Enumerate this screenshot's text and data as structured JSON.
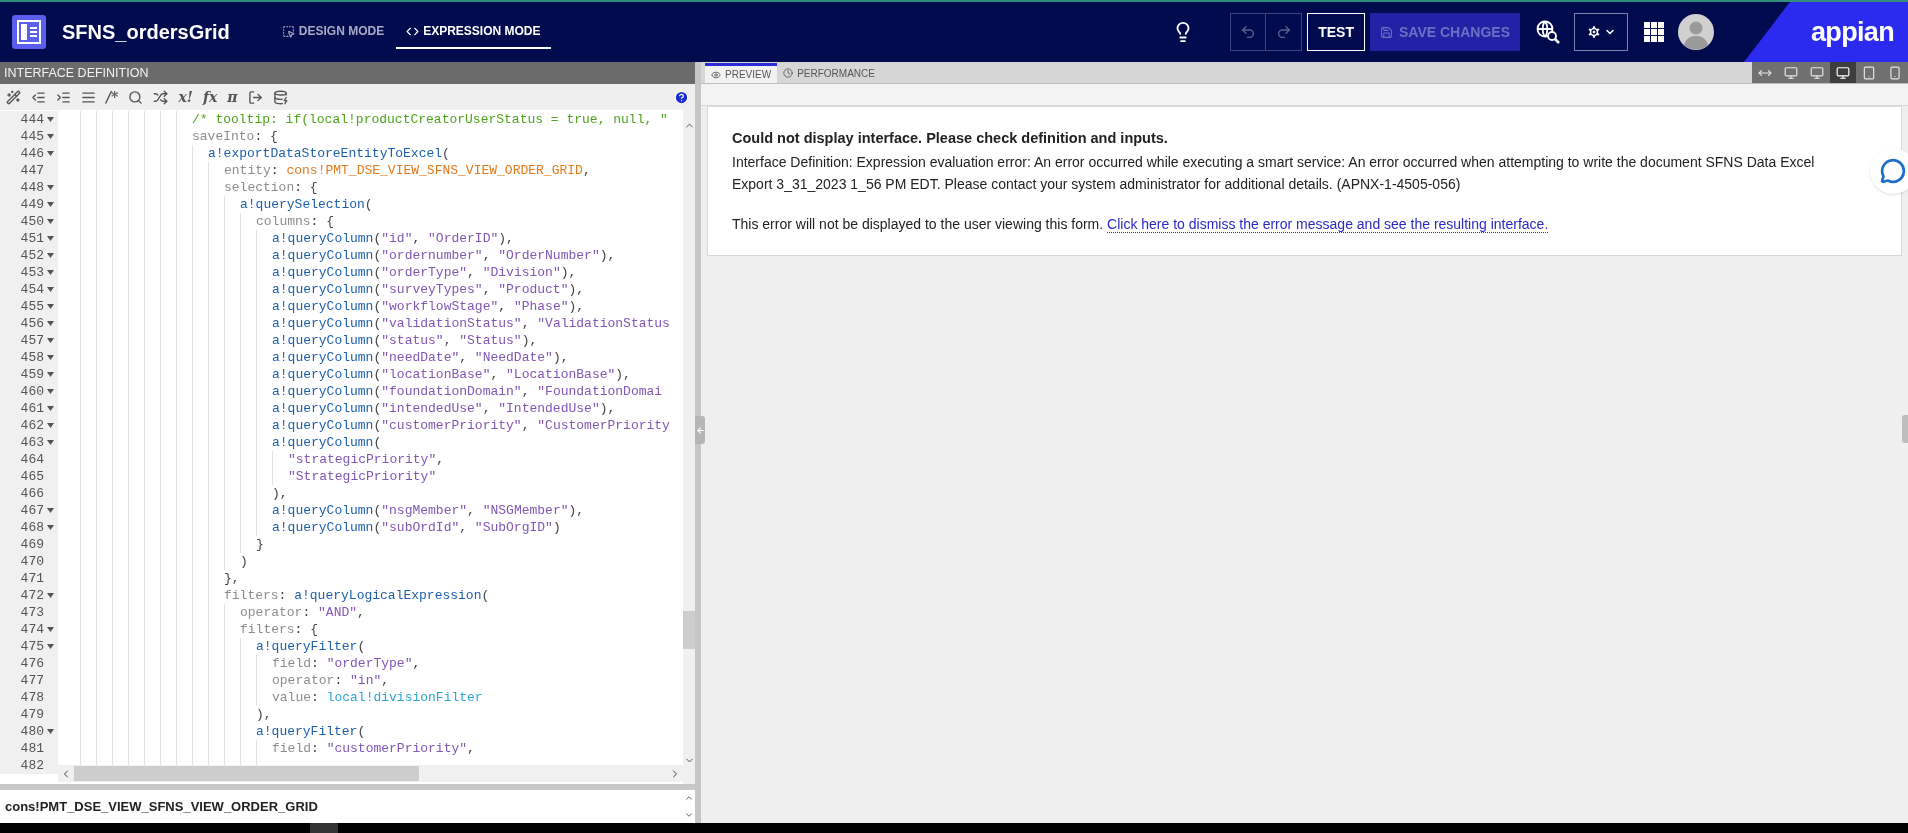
{
  "app": {
    "title": "SFNS_ordersGrid",
    "modes": [
      {
        "label": "DESIGN MODE",
        "selected": false
      },
      {
        "label": "EXPRESSION MODE",
        "selected": true
      }
    ],
    "undo": {
      "disabled": true
    },
    "redo": {
      "disabled": true
    },
    "test_button": "TEST",
    "save_button": {
      "label": "SAVE CHANGES",
      "disabled": true
    },
    "logo": "appian"
  },
  "editor": {
    "title": "INTERFACE DEFINITION",
    "toolbar": [
      {
        "kind": "icon"
      },
      {
        "kind": "icon"
      },
      {
        "kind": "icon"
      },
      {
        "kind": "icon"
      },
      {
        "kind": "glyph",
        "text": "/*"
      },
      {
        "kind": "icon"
      },
      {
        "kind": "icon"
      },
      {
        "kind": "glyph",
        "text": "x!"
      },
      {
        "kind": "glyph",
        "text": "fx"
      },
      {
        "kind": "glyph",
        "text": "π"
      },
      {
        "kind": "icon"
      },
      {
        "kind": "icon"
      }
    ],
    "lines": [
      {
        "number": "444",
        "foldable": true,
        "code": [
          {
            "kind": "comment",
            "text": "/* tooltip: if(local!productCreatorUserStatus = true, null, \""
          }
        ]
      },
      {
        "number": "445",
        "foldable": true,
        "code": [
          {
            "kind": "key",
            "text": "saveInto"
          },
          {
            "kind": "punct",
            "text": ": {"
          }
        ],
        "children": [
          {
            "number": "446",
            "foldable": true,
            "code": [
              {
                "kind": "func",
                "text": "a!exportDataStoreEntityToExcel"
              },
              {
                "kind": "punct",
                "text": "("
              }
            ],
            "children": [
              {
                "number": "447",
                "foldable": false,
                "code": [
                  {
                    "kind": "key",
                    "text": "entity"
                  },
                  {
                    "kind": "punct",
                    "text": ": "
                  },
                  {
                    "kind": "constant",
                    "text": "cons!PMT_DSE_VIEW_SFNS_VIEW_ORDER_GRID"
                  },
                  {
                    "kind": "punct",
                    "text": ","
                  }
                ]
              },
              {
                "number": "448",
                "foldable": true,
                "code": [
                  {
                    "kind": "key",
                    "text": "selection"
                  },
                  {
                    "kind": "punct",
                    "text": ": {"
                  }
                ],
                "children": [
                  {
                    "number": "449",
                    "foldable": true,
                    "code": [
                      {
                        "kind": "func",
                        "text": "a!querySelection"
                      },
                      {
                        "kind": "punct",
                        "text": "("
                      }
                    ],
                    "children": [
                      {
                        "number": "450",
                        "foldable": true,
                        "code": [
                          {
                            "kind": "key",
                            "text": "columns"
                          },
                          {
                            "kind": "punct",
                            "text": ": {"
                          }
                        ],
                        "children": [
                          {
                            "number": "451",
                            "foldable": true,
                            "code": [
                              {
                                "kind": "func",
                                "text": "a!queryColumn"
                              },
                              {
                                "kind": "punct",
                                "text": "("
                              },
                              {
                                "kind": "string",
                                "text": "\"id\""
                              },
                              {
                                "kind": "punct",
                                "text": ", "
                              },
                              {
                                "kind": "string",
                                "text": "\"OrderID\""
                              },
                              {
                                "kind": "punct",
                                "text": "),"
                              }
                            ]
                          },
                          {
                            "number": "452",
                            "foldable": true,
                            "code": [
                              {
                                "kind": "func",
                                "text": "a!queryColumn"
                              },
                              {
                                "kind": "punct",
                                "text": "("
                              },
                              {
                                "kind": "string",
                                "text": "\"ordernumber\""
                              },
                              {
                                "kind": "punct",
                                "text": ", "
                              },
                              {
                                "kind": "string",
                                "text": "\"OrderNumber\""
                              },
                              {
                                "kind": "punct",
                                "text": "),"
                              }
                            ]
                          },
                          {
                            "number": "453",
                            "foldable": true,
                            "code": [
                              {
                                "kind": "func",
                                "text": "a!queryColumn"
                              },
                              {
                                "kind": "punct",
                                "text": "("
                              },
                              {
                                "kind": "string",
                                "text": "\"orderType\""
                              },
                              {
                                "kind": "punct",
                                "text": ", "
                              },
                              {
                                "kind": "string",
                                "text": "\"Division\""
                              },
                              {
                                "kind": "punct",
                                "text": "),"
                              }
                            ]
                          },
                          {
                            "number": "454",
                            "foldable": true,
                            "code": [
                              {
                                "kind": "func",
                                "text": "a!queryColumn"
                              },
                              {
                                "kind": "punct",
                                "text": "("
                              },
                              {
                                "kind": "string",
                                "text": "\"surveyTypes\""
                              },
                              {
                                "kind": "punct",
                                "text": ", "
                              },
                              {
                                "kind": "string",
                                "text": "\"Product\""
                              },
                              {
                                "kind": "punct",
                                "text": "),"
                              }
                            ]
                          },
                          {
                            "number": "455",
                            "foldable": true,
                            "code": [
                              {
                                "kind": "func",
                                "text": "a!queryColumn"
                              },
                              {
                                "kind": "punct",
                                "text": "("
                              },
                              {
                                "kind": "string",
                                "text": "\"workflowStage\""
                              },
                              {
                                "kind": "punct",
                                "text": ", "
                              },
                              {
                                "kind": "string",
                                "text": "\"Phase\""
                              },
                              {
                                "kind": "punct",
                                "text": "),"
                              }
                            ]
                          },
                          {
                            "number": "456",
                            "foldable": true,
                            "code": [
                              {
                                "kind": "func",
                                "text": "a!queryColumn"
                              },
                              {
                                "kind": "punct",
                                "text": "("
                              },
                              {
                                "kind": "string",
                                "text": "\"validationStatus\""
                              },
                              {
                                "kind": "punct",
                                "text": ", "
                              },
                              {
                                "kind": "string",
                                "text": "\"ValidationStatus"
                              }
                            ]
                          },
                          {
                            "number": "457",
                            "foldable": true,
                            "code": [
                              {
                                "kind": "func",
                                "text": "a!queryColumn"
                              },
                              {
                                "kind": "punct",
                                "text": "("
                              },
                              {
                                "kind": "string",
                                "text": "\"status\""
                              },
                              {
                                "kind": "punct",
                                "text": ", "
                              },
                              {
                                "kind": "string",
                                "text": "\"Status\""
                              },
                              {
                                "kind": "punct",
                                "text": "),"
                              }
                            ]
                          },
                          {
                            "number": "458",
                            "foldable": true,
                            "code": [
                              {
                                "kind": "func",
                                "text": "a!queryColumn"
                              },
                              {
                                "kind": "punct",
                                "text": "("
                              },
                              {
                                "kind": "string",
                                "text": "\"needDate\""
                              },
                              {
                                "kind": "punct",
                                "text": ", "
                              },
                              {
                                "kind": "string",
                                "text": "\"NeedDate\""
                              },
                              {
                                "kind": "punct",
                                "text": "),"
                              }
                            ]
                          },
                          {
                            "number": "459",
                            "foldable": true,
                            "code": [
                              {
                                "kind": "func",
                                "text": "a!queryColumn"
                              },
                              {
                                "kind": "punct",
                                "text": "("
                              },
                              {
                                "kind": "string",
                                "text": "\"locationBase\""
                              },
                              {
                                "kind": "punct",
                                "text": ", "
                              },
                              {
                                "kind": "string",
                                "text": "\"LocationBase\""
                              },
                              {
                                "kind": "punct",
                                "text": "),"
                              }
                            ]
                          },
                          {
                            "number": "460",
                            "foldable": true,
                            "code": [
                              {
                                "kind": "func",
                                "text": "a!queryColumn"
                              },
                              {
                                "kind": "punct",
                                "text": "("
                              },
                              {
                                "kind": "string",
                                "text": "\"foundationDomain\""
                              },
                              {
                                "kind": "punct",
                                "text": ", "
                              },
                              {
                                "kind": "string",
                                "text": "\"FoundationDomai"
                              }
                            ]
                          },
                          {
                            "number": "461",
                            "foldable": true,
                            "code": [
                              {
                                "kind": "func",
                                "text": "a!queryColumn"
                              },
                              {
                                "kind": "punct",
                                "text": "("
                              },
                              {
                                "kind": "string",
                                "text": "\"intendedUse\""
                              },
                              {
                                "kind": "punct",
                                "text": ", "
                              },
                              {
                                "kind": "string",
                                "text": "\"IntendedUse\""
                              },
                              {
                                "kind": "punct",
                                "text": "),"
                              }
                            ]
                          },
                          {
                            "number": "462",
                            "foldable": true,
                            "code": [
                              {
                                "kind": "func",
                                "text": "a!queryColumn"
                              },
                              {
                                "kind": "punct",
                                "text": "("
                              },
                              {
                                "kind": "string",
                                "text": "\"customerPriority\""
                              },
                              {
                                "kind": "punct",
                                "text": ", "
                              },
                              {
                                "kind": "string",
                                "text": "\"CustomerPriority"
                              }
                            ]
                          },
                          {
                            "number": "463",
                            "foldable": true,
                            "code": [
                              {
                                "kind": "func",
                                "text": "a!queryColumn"
                              },
                              {
                                "kind": "punct",
                                "text": "("
                              }
                            ],
                            "children": [
                              {
                                "number": "464",
                                "foldable": false,
                                "code": [
                                  {
                                    "kind": "string",
                                    "text": "\"strategicPriority\""
                                  },
                                  {
                                    "kind": "punct",
                                    "text": ","
                                  }
                                ]
                              },
                              {
                                "number": "465",
                                "foldable": false,
                                "code": [
                                  {
                                    "kind": "string",
                                    "text": "\"StrategicPriority\""
                                  }
                                ]
                              }
                            ]
                          },
                          {
                            "number": "466",
                            "foldable": false,
                            "code": [
                              {
                                "kind": "punct",
                                "text": "),"
                              }
                            ]
                          },
                          {
                            "number": "467",
                            "foldable": true,
                            "code": [
                              {
                                "kind": "func",
                                "text": "a!queryColumn"
                              },
                              {
                                "kind": "punct",
                                "text": "("
                              },
                              {
                                "kind": "string",
                                "text": "\"nsgMember\""
                              },
                              {
                                "kind": "punct",
                                "text": ", "
                              },
                              {
                                "kind": "string",
                                "text": "\"NSGMember\""
                              },
                              {
                                "kind": "punct",
                                "text": "),"
                              }
                            ]
                          },
                          {
                            "number": "468",
                            "foldable": true,
                            "code": [
                              {
                                "kind": "func",
                                "text": "a!queryColumn"
                              },
                              {
                                "kind": "punct",
                                "text": "("
                              },
                              {
                                "kind": "string",
                                "text": "\"subOrdId\""
                              },
                              {
                                "kind": "punct",
                                "text": ", "
                              },
                              {
                                "kind": "string",
                                "text": "\"SubOrgID\""
                              },
                              {
                                "kind": "punct",
                                "text": ")"
                              }
                            ]
                          }
                        ]
                      },
                      {
                        "number": "469",
                        "foldable": false,
                        "code": [
                          {
                            "kind": "punct",
                            "text": "}"
                          }
                        ]
                      }
                    ]
                  },
                  {
                    "number": "470",
                    "foldable": false,
                    "code": [
                      {
                        "kind": "punct",
                        "text": ")"
                      }
                    ]
                  }
                ]
              },
              {
                "number": "471",
                "foldable": false,
                "code": [
                  {
                    "kind": "punct",
                    "text": "},"
                  }
                ]
              },
              {
                "number": "472",
                "foldable": true,
                "code": [
                  {
                    "kind": "key",
                    "text": "filters"
                  },
                  {
                    "kind": "punct",
                    "text": ": "
                  },
                  {
                    "kind": "func",
                    "text": "a!queryLogicalExpression"
                  },
                  {
                    "kind": "punct",
                    "text": "("
                  }
                ],
                "children": [
                  {
                    "number": "473",
                    "foldable": false,
                    "code": [
                      {
                        "kind": "key",
                        "text": "operator"
                      },
                      {
                        "kind": "punct",
                        "text": ": "
                      },
                      {
                        "kind": "string",
                        "text": "\"AND\""
                      },
                      {
                        "kind": "punct",
                        "text": ","
                      }
                    ]
                  },
                  {
                    "number": "474",
                    "foldable": true,
                    "code": [
                      {
                        "kind": "key",
                        "text": "filters"
                      },
                      {
                        "kind": "punct",
                        "text": ": {"
                      }
                    ],
                    "children": [
                      {
                        "number": "475",
                        "foldable": true,
                        "code": [
                          {
                            "kind": "func",
                            "text": "a!queryFilter"
                          },
                          {
                            "kind": "punct",
                            "text": "("
                          }
                        ],
                        "children": [
                          {
                            "number": "476",
                            "foldable": false,
                            "code": [
                              {
                                "kind": "key",
                                "text": "field"
                              },
                              {
                                "kind": "punct",
                                "text": ": "
                              },
                              {
                                "kind": "string",
                                "text": "\"orderType\""
                              },
                              {
                                "kind": "punct",
                                "text": ","
                              }
                            ]
                          },
                          {
                            "number": "477",
                            "foldable": false,
                            "code": [
                              {
                                "kind": "key",
                                "text": "operator"
                              },
                              {
                                "kind": "punct",
                                "text": ": "
                              },
                              {
                                "kind": "string",
                                "text": "\"in\""
                              },
                              {
                                "kind": "punct",
                                "text": ","
                              }
                            ]
                          },
                          {
                            "number": "478",
                            "foldable": false,
                            "code": [
                              {
                                "kind": "key",
                                "text": "value"
                              },
                              {
                                "kind": "punct",
                                "text": ": "
                              },
                              {
                                "kind": "local",
                                "text": "local!divisionFilter"
                              }
                            ]
                          }
                        ]
                      },
                      {
                        "number": "479",
                        "foldable": false,
                        "code": [
                          {
                            "kind": "punct",
                            "text": "),"
                          }
                        ]
                      },
                      {
                        "number": "480",
                        "foldable": true,
                        "code": [
                          {
                            "kind": "func",
                            "text": "a!queryFilter"
                          },
                          {
                            "kind": "punct",
                            "text": "("
                          }
                        ],
                        "children": [
                          {
                            "number": "481",
                            "foldable": false,
                            "code": [
                              {
                                "kind": "key",
                                "text": "field"
                              },
                              {
                                "kind": "punct",
                                "text": ": "
                              },
                              {
                                "kind": "string",
                                "text": "\"customerPriority\""
                              },
                              {
                                "kind": "punct",
                                "text": ","
                              }
                            ]
                          },
                          {
                            "number": "482",
                            "foldable": false
                          }
                        ]
                      }
                    ]
                  }
                ]
              }
            ]
          }
        ]
      }
    ],
    "expression": "cons!PMT_DSE_VIEW_SFNS_VIEW_ORDER_GRID"
  },
  "preview": {
    "tabs": [
      {
        "label": "PREVIEW",
        "selected": true
      },
      {
        "label": "PERFORMANCE",
        "selected": false
      }
    ],
    "devices": [
      {
        "selected": false
      },
      {
        "selected": false
      },
      {
        "selected": false
      },
      {
        "selected": true
      },
      {
        "selected": false
      },
      {
        "selected": false
      }
    ],
    "error": {
      "title": "Could not display interface. Please check definition and inputs.",
      "message": "Interface Definition: Expression evaluation error: An error occurred while executing a smart service: An error occurred when attempting to write the document SFNS Data Excel Export 3_31_2023 1_56 PM EDT. Please contact your system administrator for additional details. (APNX-1-4505-056)",
      "note": "This error will not be displayed to the user viewing this form.",
      "link": "Click here to dismiss the error message and see the resulting interface."
    }
  }
}
